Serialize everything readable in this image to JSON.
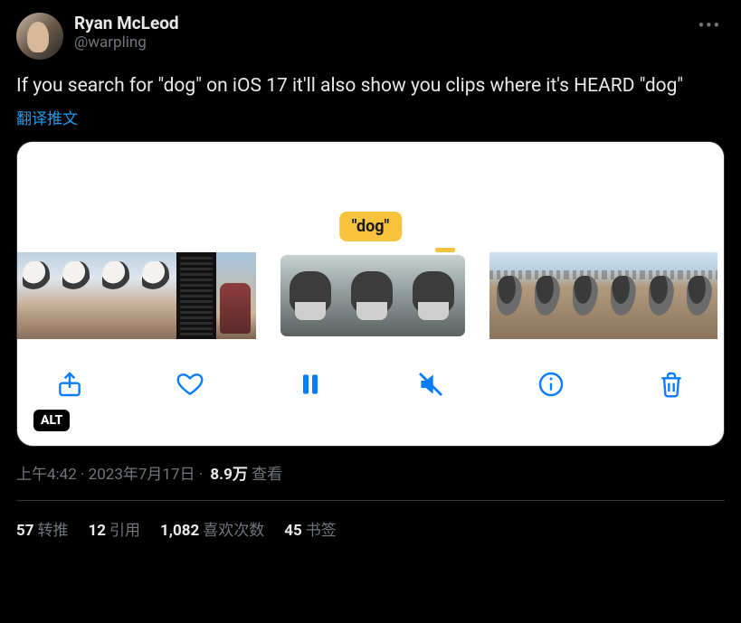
{
  "author": {
    "display_name": "Ryan McLeod",
    "handle": "@warpling"
  },
  "tweet_text": "If you search for \"dog\" on iOS 17 it'll also show you clips where it's HEARD \"dog\"",
  "translate_label": "翻译推文",
  "media": {
    "caption_pill": "\"dog\"",
    "alt_badge": "ALT"
  },
  "meta": {
    "time": "上午4:42",
    "date": "2023年7月17日",
    "separator": " · ",
    "views_count": "8.9万",
    "views_label": "查看"
  },
  "stats": {
    "retweets": {
      "count": "57",
      "label": "转推"
    },
    "quotes": {
      "count": "12",
      "label": "引用"
    },
    "likes": {
      "count": "1,082",
      "label": "喜欢次数"
    },
    "bookmarks": {
      "count": "45",
      "label": "书签"
    }
  }
}
